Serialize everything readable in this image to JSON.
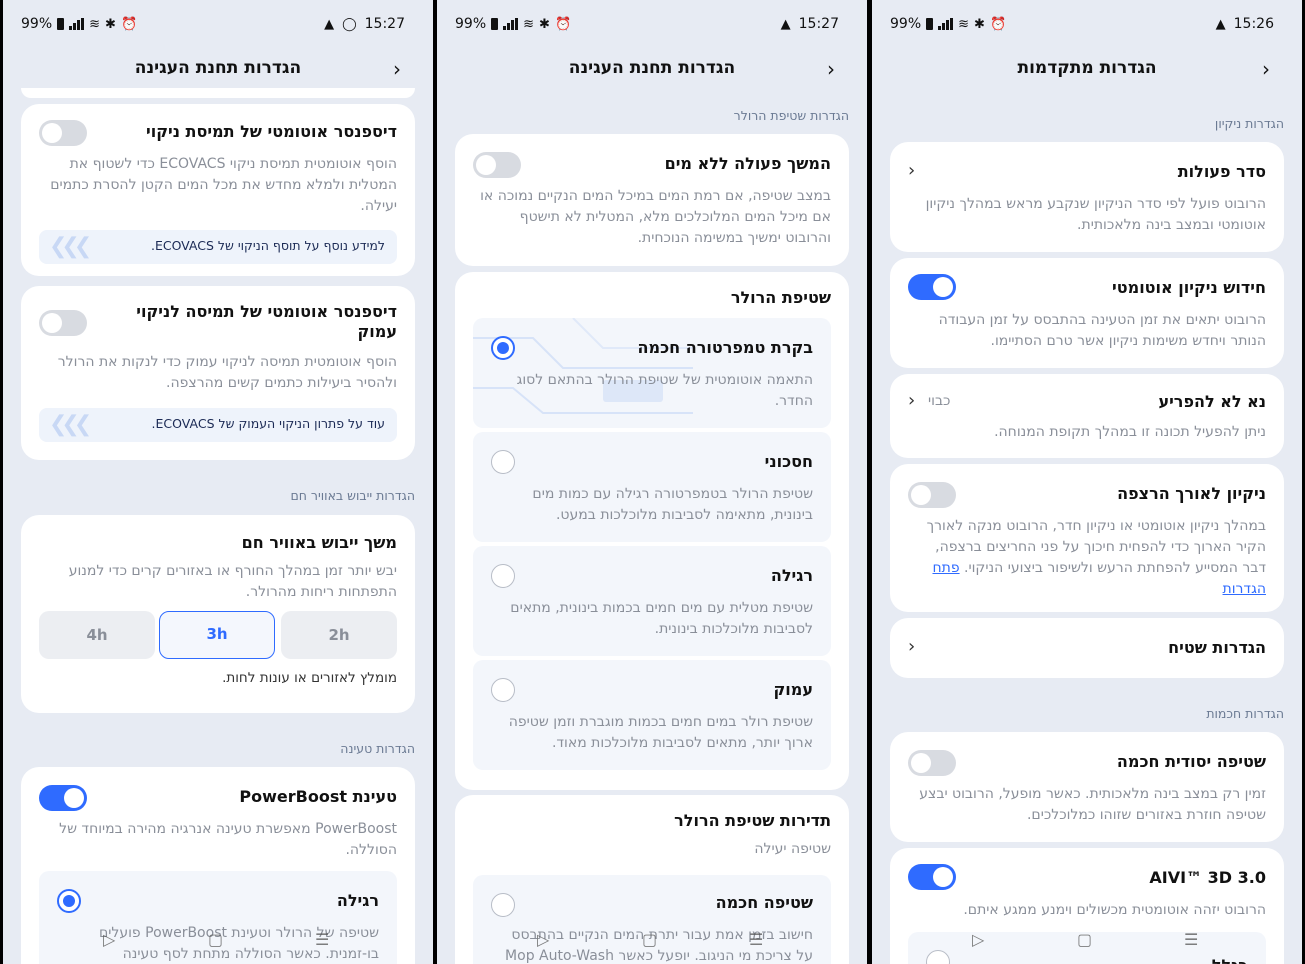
{
  "status": {
    "battery": "99%",
    "s1_time": "15:27",
    "s2_time": "15:27",
    "s3_time": "15:26"
  },
  "screen1": {
    "title": "הגדרות תחנת העגינה",
    "dispenser1": {
      "title": "דיספנסר אוטומטי של תמיסת ניקוי",
      "desc": "הוסף אוטומטית תמיסת ניקוי ECOVACS כדי לשטוף את המטלית ולמלא מחדש את מכל המים הקטן להסרת כתמים יעילה.",
      "tip": "למידע נוסף על תוסף הניקוי של ECOVACS."
    },
    "dispenser2": {
      "title": "דיספנסר אוטומטי של תמיסה לניקוי עמוק",
      "desc": "הוסף אוטומטית תמיסה לניקוי עמוק כדי לנקות את הרולר ולהסיר ביעילות כתמים קשים מהרצפה.",
      "tip": "עוד על פתרון הניקוי העמוק של ECOVACS."
    },
    "dry_section": "הגדרות ייבוש באוויר חם",
    "dry": {
      "title": "משך ייבוש באוויר חם",
      "desc": "יבש יותר זמן במהלך החורף או באזורים קרים כדי למנוע התפתחות ריחות מהרולר.",
      "opt_2h": "2h",
      "opt_3h": "3h",
      "opt_4h": "4h",
      "note": "מומלץ לאזורים או עונות לחות."
    },
    "charge_section": "הגדרות טעינה",
    "powerboost": {
      "title": "טעינת PowerBoost",
      "desc": "PowerBoost מאפשרת טעינה אנרגיה מהירה במיוחד של הסוללה.",
      "opt_title": "רגילה",
      "opt_desc": "שטיפה של הרולר וטעינת PowerBoost פועלים בו-זמנית. כאשר הסוללה מתחת לסף טעינה"
    }
  },
  "screen2": {
    "title": "הגדרות תחנת העגינה",
    "section": "הגדרות שטיפת הרולר",
    "continue": {
      "title": "המשך פעולה ללא מים",
      "desc": "במצב שטיפה, אם רמת המים במיכל המים הנקיים נמוכה או אם מיכל המים המלוכלכים מלא, המטלית לא תישטף והרובוט ימשיך במשימה הנוכחית."
    },
    "roller": {
      "title": "שטיפת הרולר",
      "options": [
        {
          "title": "בקרת טמפרטורה חכמה",
          "desc": "התאמה אוטומטית של שטיפת הרולר בהתאם לסוג החדר."
        },
        {
          "title": "חסכוני",
          "desc": "שטיפת הרולר בטמפרטורה רגילה עם כמות מים בינונית, מתאימה לסביבות מלוכלכות במעט."
        },
        {
          "title": "רגילה",
          "desc": "שטיפת מטלית עם מים חמים בכמות בינונית, מתאים לסביבות מלוכלכות בינונית."
        },
        {
          "title": "עמוק",
          "desc": "שטיפת רולר במים חמים בכמות מוגברת וזמן שטיפה ארוך יותר, מתאים לסביבות מלוכלכות מאוד."
        }
      ]
    },
    "frequency": {
      "title": "תדירות שטיפת הרולר",
      "subtitle": "שטיפה יעילה",
      "opt_title": "שטיפה חכמה",
      "opt_desc": "חישוב בזמן אמת עבור יתרת המים הנקיים בהתבסס על צריכת מי הניגוב. יופעל כאשר Mop Auto-Wash"
    }
  },
  "screen3": {
    "title": "הגדרות מתקדמות",
    "clean_section": "הגדרות ניקיון",
    "order": {
      "title": "סדר פעולות",
      "desc": "הרובוט פועל לפי סדר הניקיון שנקבע מראש במהלך ניקיון אוטומטי ובמצב בינה מלאכותית."
    },
    "resume": {
      "title": "חידוש ניקיון אוטומטי",
      "desc": "הרובוט יתאים את זמן הטעינה בהתבסס על זמן העבודה הנותר ויחדש משימות ניקיון אשר טרם הסתיימו."
    },
    "dnd": {
      "title": "נא לא להפריע",
      "value": "כבוי",
      "desc": "ניתן להפעיל תכונה זו במהלך תקופת המנוחה."
    },
    "edge": {
      "title": "ניקיון לאורך הרצפה",
      "desc": "במהלך ניקיון אוטומטי או ניקיון חדר, הרובוט מנקה לאורך הקיר הארוך כדי להפחית חיכוך על פני החריצים ברצפה, דבר המסייע להפחתת הרעש ולשיפור ביצועי הניקוי.",
      "link": "פתח הגדרות"
    },
    "area": {
      "title": "הגדרות שטיח"
    },
    "smart_section": "הגדרות חכמות",
    "deep_mop": {
      "title": "שטיפה יסודית חכמה",
      "desc": "זמין רק במצב בינה מלאכותית. כאשר מופעל, הרובוט יבצע שטיפה חוזרת באזורים שזוהו כמלוכלכים."
    },
    "aivi": {
      "title": "AIVI™ 3D 3.0",
      "desc": "הרובוט יזהה אוטומטית מכשולים וימנע ממגע איתם."
    },
    "partial": "בגלל"
  }
}
